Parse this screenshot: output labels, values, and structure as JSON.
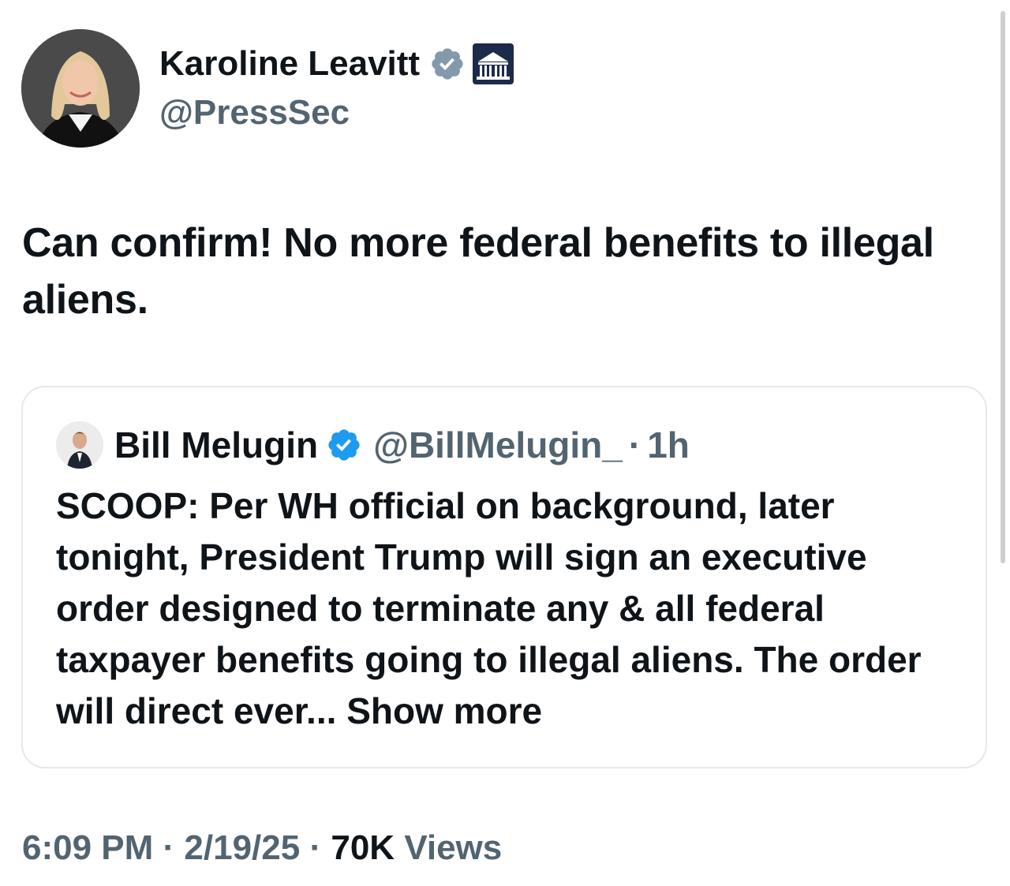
{
  "tweet": {
    "author": {
      "display_name": "Karoline Leavitt",
      "handle": "@PressSec",
      "verified_badge_color": "#829aab",
      "affiliate_badge": "white-house-icon"
    },
    "text": "Can confirm! No more federal benefits to illegal aliens.",
    "quoted": {
      "display_name": "Bill Melugin",
      "handle": "@BillMelugin_",
      "separator": "·",
      "time": "1h",
      "verified_badge_color": "#1d9bf0",
      "text": "SCOOP: Per WH official on background, later tonight, President Trump will sign an executive order designed to terminate any & all federal taxpayer benefits going to illegal aliens. The order will direct ever...",
      "show_more": "Show more"
    },
    "meta": {
      "time": "6:09 PM",
      "separator": "·",
      "date": "2/19/25",
      "views_count": "70K",
      "views_label": "Views"
    }
  },
  "colors": {
    "text_primary": "#0f1419",
    "text_secondary": "#536471",
    "border": "#e6e9ec"
  }
}
